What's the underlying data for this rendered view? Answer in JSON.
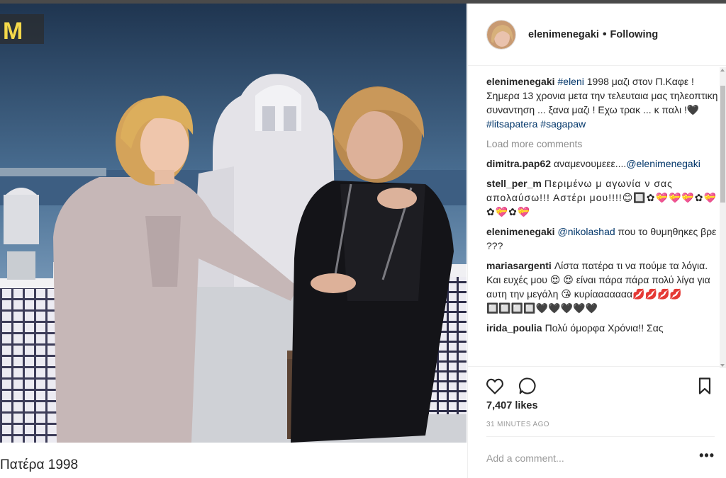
{
  "media": {
    "caption_below": "Πατέρα 1998"
  },
  "post": {
    "username": "elenimenegaki",
    "dot": "•",
    "follow_status": "Following",
    "caption_user": "elenimenegaki",
    "caption_tag1": "#eleni",
    "caption_text": " 1998 μαζι στον Π.Καφε ! Σημερα 13 χρονια μετα την τελευταια μας τηλεοπτικη συναντηση ... ξανα μαζι ! Εχω τρακ ... κ παλι !🖤",
    "caption_tag2": "#litsapatera",
    "caption_tag3": "#sagapaw",
    "load_more": "Load more comments",
    "comments": [
      {
        "user": "dimitra.pap62",
        "text": "αναμενουμεεε....",
        "mention": "@elenimenegaki"
      },
      {
        "user": "stell_per_m",
        "text": "Περιμένω μ αγωνία ν σας απολαύσω!!! Αστέρι μου!!!!😊🔲✿💝💝💝✿💝✿💝✿💝"
      },
      {
        "user": "elenimenegaki",
        "mention": "@nikolashad",
        "text": " που το θυμηθηκες βρε ???"
      },
      {
        "user": "mariasargenti",
        "text": "Λίστα πατέρα τι να πούμε τα λόγια. Και ευχές μου 😍 😍 είναι πάρα πάρα πολύ λίγα για αυτη την μεγάλη 😘 κυρίααααααα💋💋💋💋🔲🔲🔲🔲🖤🖤🖤🖤🖤"
      },
      {
        "user": "irida_poulia",
        "text": "Πολύ όμορφα Χρόνια!! Σας"
      }
    ],
    "likes": "7,407 likes",
    "time_ago": "31 MINUTES AGO",
    "add_comment_placeholder": "Add a comment...",
    "more_options": "•••"
  },
  "icons": {
    "like": "heart-icon",
    "comment": "comment-icon",
    "save": "bookmark-icon"
  },
  "colors": {
    "link": "#003569",
    "muted": "#8e8e8e",
    "text": "#262626"
  }
}
